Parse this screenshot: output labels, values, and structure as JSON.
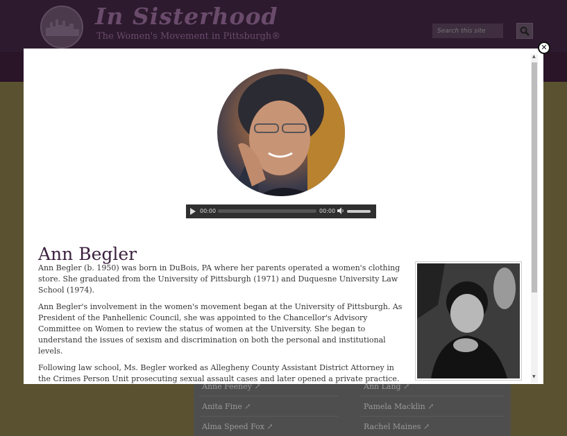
{
  "site": {
    "title": "In Sisterhood",
    "subtitle": "The Women's Movement in Pittsburgh®",
    "search_placeholder": "Search this site"
  },
  "background_list": [
    {
      "name": "Anne Feeney ↗"
    },
    {
      "name": "Ann Lang ↗"
    },
    {
      "name": "Anita Fine ↗"
    },
    {
      "name": "Pamela Macklin ↗"
    },
    {
      "name": "Alma Speed Fox ↗"
    },
    {
      "name": "Rachel Maines ↗"
    }
  ],
  "modal": {
    "close_label": "✕",
    "person_name": "Ann Begler",
    "audio": {
      "current_time": "00:00",
      "duration": "00:00"
    },
    "bio": [
      "Ann Begler (b. 1950) was born in DuBois, PA where her parents operated a women's clothing store. She graduated from the University of Pittsburgh (1971) and Duquesne University Law School (1974).",
      "Ann Begler's involvement in the women's movement began at the University of Pittsburgh. As President of the Panhellenic Council, she was appointed to the Chancellor's Advisory Committee on Women to review the status of women at the University. She began to understand the issues of sexism and discrimination on both the personal and institutional levels.",
      "Following law school, Ms. Begler worked as Allegheny County Assistant District Attorney in the Crimes Person Unit prosecuting sexual assault cases and later opened a private practice.  Ann represented both Pittsburgh Action Against Rape and the Pennsylvania Coalition Against Rape on cases that substantially changed the way sexual assault victims were to be treated within the justice system. In a landmark case, she successfully argued for"
    ]
  },
  "colors": {
    "header_bg": "#2d1a2e",
    "title_color": "#3a1f3d",
    "body_bg": "#5a5130"
  }
}
